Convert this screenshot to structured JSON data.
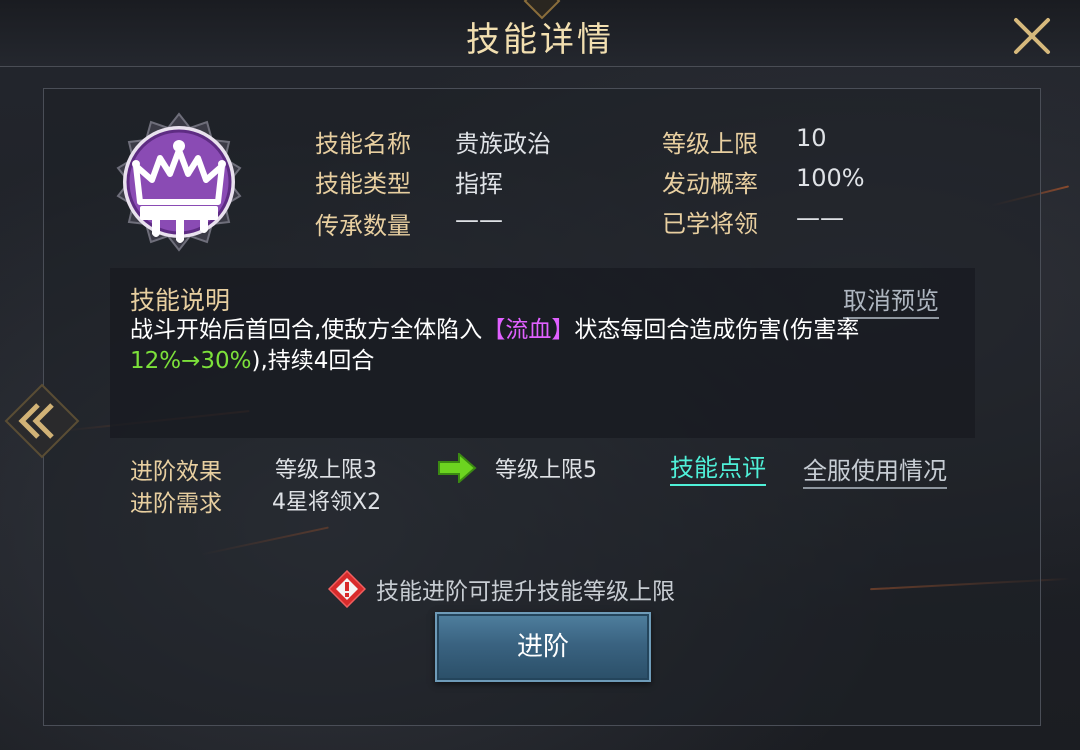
{
  "window": {
    "title": "技能详情"
  },
  "skill": {
    "info_rows": [
      {
        "label": "技能名称",
        "value": "贵族政治"
      },
      {
        "label": "技能类型",
        "value": "指挥"
      },
      {
        "label": "传承数量",
        "value": "——"
      }
    ],
    "info_rows_right": [
      {
        "label": "等级上限",
        "value": "10"
      },
      {
        "label": "发动概率",
        "value": "100%"
      },
      {
        "label": "已学将领",
        "value": "——"
      }
    ]
  },
  "description": {
    "title": "技能说明",
    "cancel_preview": "取消预览",
    "text_part1": "战斗开始后首回合,使敌方全体陷入",
    "status_tag": "【流血】",
    "text_part2": "状态每回合造成伤害(伤害率",
    "rate": "12%→30%",
    "text_part3": "),持续4回合"
  },
  "advance": {
    "effect_label": "进阶效果",
    "effect_from": "等级上限3",
    "effect_to": "等级上限5",
    "requirement_label": "进阶需求",
    "requirement_value": "4星将领X2",
    "review_link": "技能点评",
    "usage_link": "全服使用情况"
  },
  "warning": {
    "text": "技能进阶可提升技能等级上限"
  },
  "button": {
    "label": "进阶"
  },
  "icons": {
    "close": "close-icon",
    "emblem": "crown-icon",
    "arrow": "arrow-right-icon",
    "warning": "warning-icon",
    "side": "double-chevron-left-icon"
  },
  "colors": {
    "gold_text": "#e8cfa0",
    "emblem_purple": "#8a4bb4",
    "highlight_purple": "#e060ff",
    "highlight_green": "#7ce03a",
    "link_cyan": "#4ff0d8",
    "button_blue": "#3a6381",
    "warning_red": "#d82b2b"
  }
}
